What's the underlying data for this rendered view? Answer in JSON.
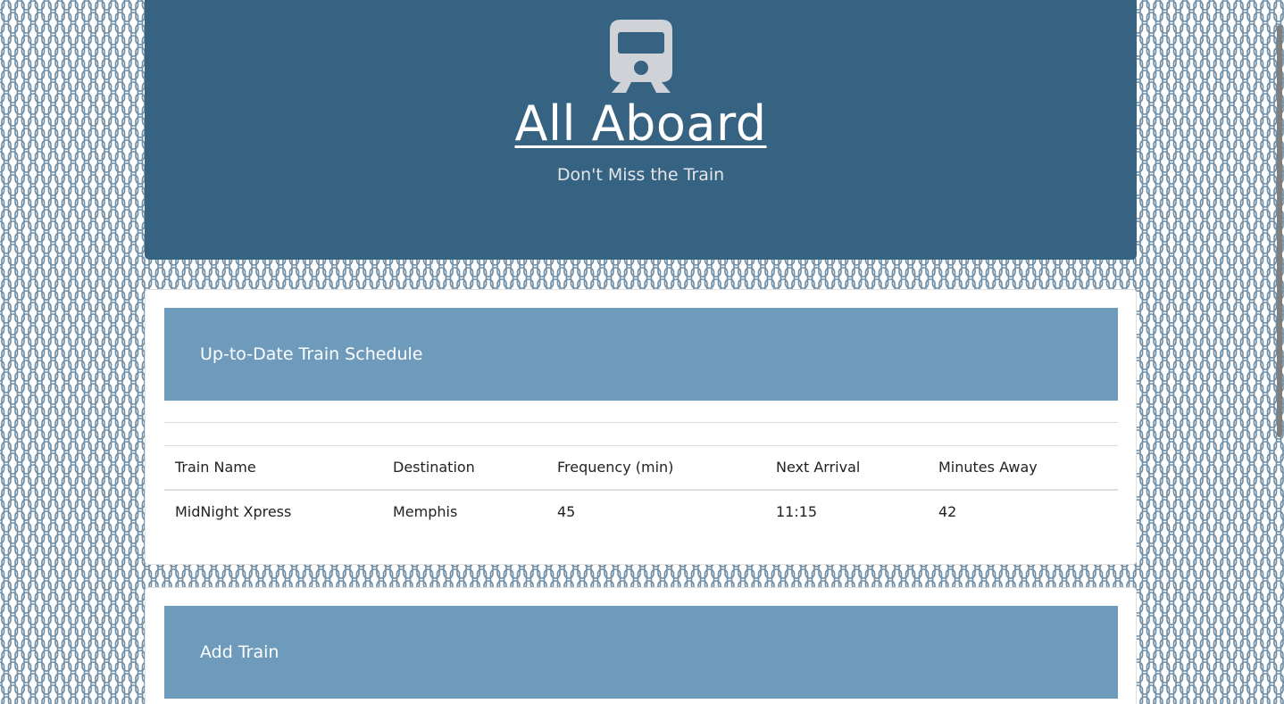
{
  "header": {
    "icon": "train-icon",
    "title": "All Aboard",
    "subtitle": "Don't Miss the Train"
  },
  "colors": {
    "header_bg": "#376383",
    "panel_heading_bg": "#6e9bbb",
    "pattern": "#6f8ea6"
  },
  "schedule": {
    "heading": "Up-to-Date Train Schedule",
    "columns": [
      "Train Name",
      "Destination",
      "Frequency (min)",
      "Next Arrival",
      "Minutes Away"
    ],
    "rows": [
      [
        "MidNight Xpress",
        "Memphis",
        "45",
        "11:15",
        "42"
      ]
    ]
  },
  "add_train": {
    "heading": "Add Train"
  }
}
